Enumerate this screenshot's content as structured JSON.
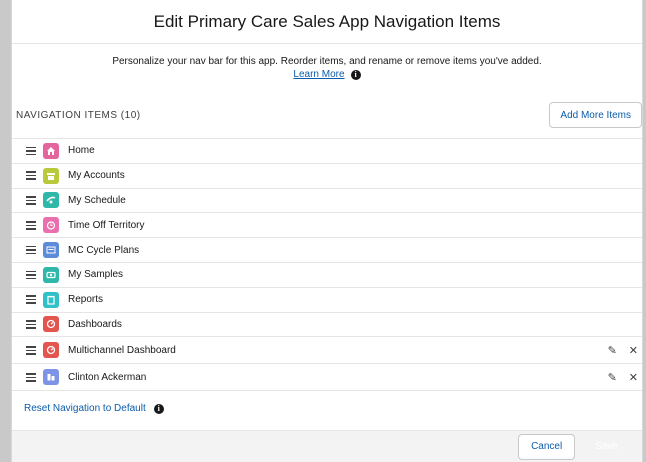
{
  "modal": {
    "title": "Edit Primary Care Sales App Navigation Items",
    "description": "Personalize your nav bar for this app. Reorder items, and rename or remove items you've added.",
    "learn_more": "Learn More",
    "section_title": "NAVIGATION ITEMS (10)",
    "add_button": "Add More Items",
    "reset_link": "Reset Navigation to Default",
    "cancel_button": "Cancel",
    "save_button": "Save"
  },
  "items": [
    {
      "label": "Home",
      "icon": "home-icon",
      "color": "#e3659e"
    },
    {
      "label": "My Accounts",
      "icon": "accounts-icon",
      "color": "#b8c93a"
    },
    {
      "label": "My Schedule",
      "icon": "schedule-icon",
      "color": "#2fb8aa"
    },
    {
      "label": "Time Off Territory",
      "icon": "clock-icon",
      "color": "#e96fae"
    },
    {
      "label": "MC Cycle Plans",
      "icon": "cycle-plans-icon",
      "color": "#5b8bd9"
    },
    {
      "label": "My Samples",
      "icon": "samples-icon",
      "color": "#2fb8aa"
    },
    {
      "label": "Reports",
      "icon": "reports-icon",
      "color": "#2fc0c9"
    },
    {
      "label": "Dashboards",
      "icon": "dashboard-icon",
      "color": "#e3554f"
    },
    {
      "label": "Multichannel Dashboard",
      "icon": "dashboard-icon",
      "color": "#e3554f"
    },
    {
      "label": "Clinton Ackerman",
      "icon": "record-icon",
      "color": "#7c93e6"
    }
  ]
}
